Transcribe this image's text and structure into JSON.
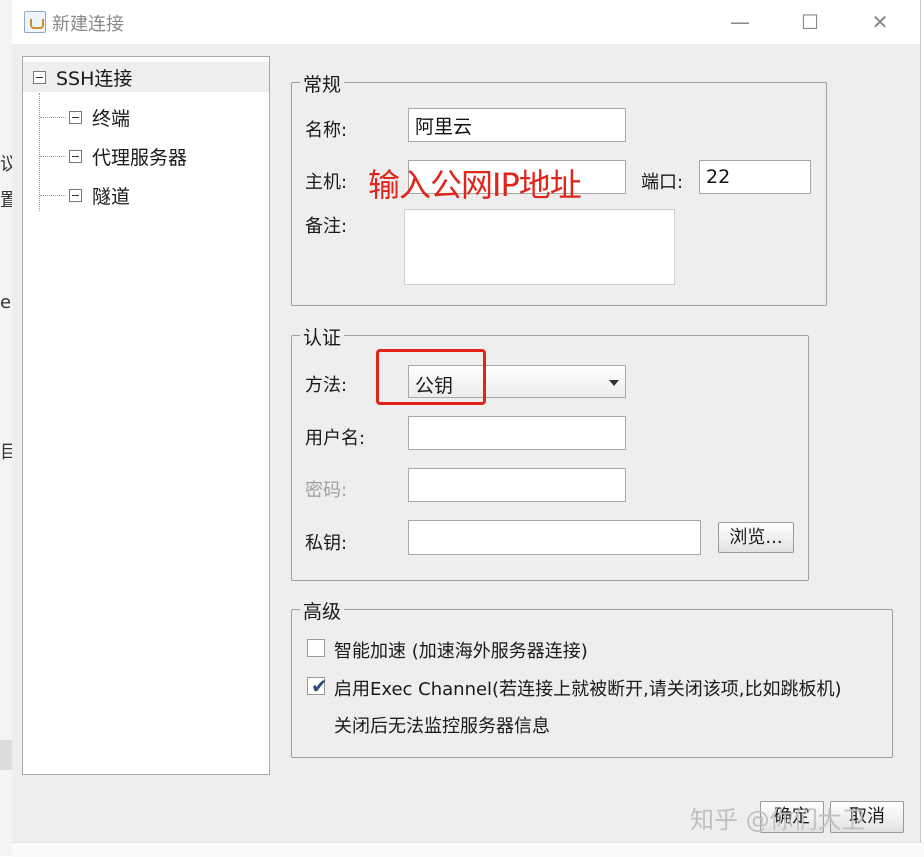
{
  "window": {
    "title": "新建连接"
  },
  "tree": {
    "root": "SSH连接",
    "children": [
      "终端",
      "代理服务器",
      "隧道"
    ]
  },
  "general": {
    "title": "常规",
    "name_label": "名称:",
    "name_value": "阿里云",
    "host_label": "主机:",
    "host_value": "",
    "port_label": "端口:",
    "port_value": "22",
    "notes_label": "备注:"
  },
  "auth": {
    "title": "认证",
    "method_label": "方法:",
    "method_value": "公钥",
    "username_label": "用户名:",
    "password_label": "密码:",
    "private_key_label": "私钥:",
    "browse_button": "浏览..."
  },
  "advanced": {
    "title": "高级",
    "smart_accel_label": "智能加速 (加速海外服务器连接)",
    "smart_accel_checked": false,
    "exec_channel_label": "启用Exec Channel(若连接上就被断开,请关闭该项,比如跳板机)",
    "exec_channel_checked": true,
    "exec_channel_note": "关闭后无法监控服务器信息"
  },
  "footer": {
    "ok_button": "确定",
    "cancel_button": "取消"
  },
  "annotations": {
    "host_hint": "输入公网IP地址",
    "highlight_color": "#e0251b"
  },
  "watermark": "知乎 @你们大卫"
}
